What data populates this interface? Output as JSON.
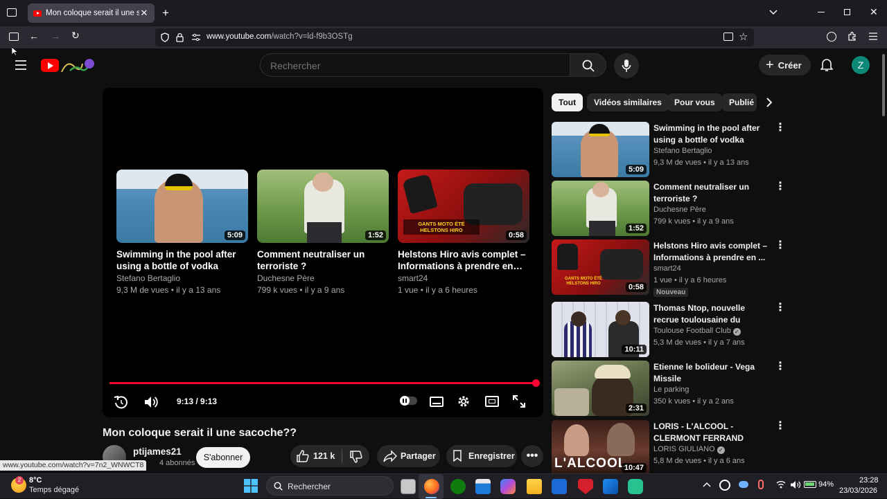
{
  "browser": {
    "tab_title": "Mon coloque serait il une sacoche",
    "url_domain": "www.youtube.com",
    "url_path": "/watch?v=ld-f9b3OSTg",
    "status_url": "www.youtube.com/watch?v=7n2_WNWCT8"
  },
  "header": {
    "search_placeholder": "Rechercher",
    "create_label": "Créer",
    "avatar_letter": "Z"
  },
  "player": {
    "time": "9:13 / 9:13",
    "progress": 1.0,
    "endcards": [
      {
        "title": "Swimming in the pool after using a bottle of vodka",
        "channel": "Stefano Bertaglio",
        "meta": "9,3 M de vues • il y a 13 ans",
        "duration": "5:09"
      },
      {
        "title": "Comment neutraliser un terroriste ?",
        "channel": "Duchesne Père",
        "meta": "799 k vues • il y a 9 ans",
        "duration": "1:52"
      },
      {
        "title": "Helstons Hiro avis complet – Informations à prendre en…",
        "channel": "smart24",
        "meta": "1 vue • il y a 6 heures",
        "duration": "0:58",
        "thumb_text": "GANTS MOTO ÉTÉ HELSTONS HIRO"
      }
    ]
  },
  "video": {
    "title": "Mon coloque serait il une sacoche??",
    "channel": "ptijames21",
    "subscribers": "4 abonnés",
    "subscribe_label": "S'abonner",
    "likes": "121 k",
    "share_label": "Partager",
    "save_label": "Enregistrer"
  },
  "chips": [
    "Tout",
    "Vidéos similaires",
    "Pour vous",
    "Publié"
  ],
  "recommendations": [
    {
      "title": "Swimming in the pool after using a bottle of vodka",
      "channel": "Stefano Bertaglio",
      "verified": false,
      "meta": "9,3 M de vues • il y a 13 ans",
      "duration": "5:09",
      "badge": ""
    },
    {
      "title": "Comment neutraliser un terroriste ?",
      "channel": "Duchesne Père",
      "verified": false,
      "meta": "799 k vues • il y a 9 ans",
      "duration": "1:52",
      "badge": ""
    },
    {
      "title": "Helstons Hiro avis complet – Informations à prendre en ...",
      "channel": "smart24",
      "verified": false,
      "meta": "1 vue • il y a 6 heures",
      "duration": "0:58",
      "badge": "Nouveau"
    },
    {
      "title": "Thomas Ntop, nouvelle recrue toulousaine du mercato hivernal",
      "channel": "Toulouse Football Club",
      "verified": true,
      "meta": "5,3 M de vues • il y a 7 ans",
      "duration": "10:11",
      "badge": ""
    },
    {
      "title": "Etienne le bolideur - Vega Missile",
      "channel": "Le parking",
      "verified": false,
      "meta": "350 k vues • il y a 2 ans",
      "duration": "2:31",
      "badge": ""
    },
    {
      "title": "LORIS - L'ALCOOL - CLERMONT FERRAND",
      "channel": "LORIS GIULIANO",
      "verified": true,
      "meta": "5,8 M de vues • il y a 6 ans",
      "duration": "10:47",
      "badge": "",
      "thumb_text": "L'ALCOOL"
    }
  ],
  "taskbar": {
    "weather_temp": "8°C",
    "weather_desc": "Temps dégagé",
    "search_label": "Rechercher",
    "battery": "94%",
    "time": "23:28",
    "date": "23/03/2026"
  },
  "colors": {
    "progress": "#ff0033",
    "yt_red": "#ff0000",
    "avatar": "#0d8a77"
  }
}
